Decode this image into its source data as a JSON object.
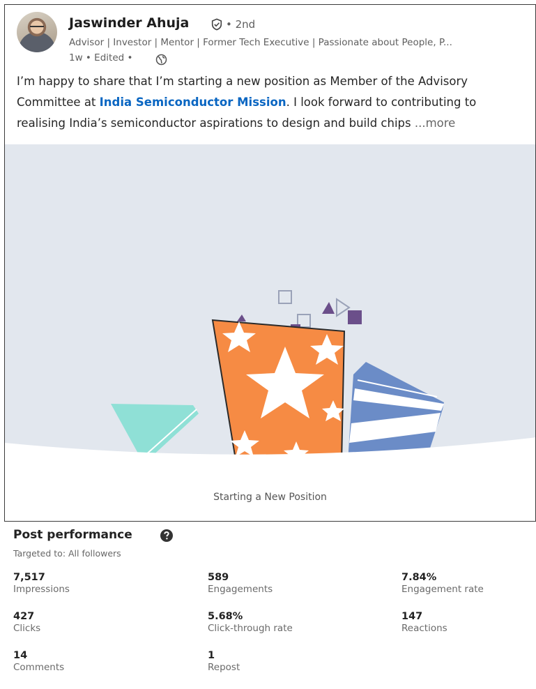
{
  "author": {
    "name": "Jaswinder Ahuja",
    "degree": "• 2nd",
    "headline": "Advisor | Investor | Mentor | Former Tech Executive | Passionate about People, P...",
    "meta": "1w • Edited •"
  },
  "post": {
    "text_part1": "I’m happy to share that I’m starting a new position as Member of the Advisory Committee at ",
    "org_link": "India Semiconductor Mission",
    "text_part2": ". I look forward to contributing to realising India’s semiconductor aspirations to design and build chips ",
    "more_label": "...more",
    "media_caption": "Starting a New Position"
  },
  "performance": {
    "title": "Post performance",
    "targeted": "Targeted to: All followers",
    "metrics": [
      {
        "value": "7,517",
        "label": "Impressions"
      },
      {
        "value": "589",
        "label": "Engagements"
      },
      {
        "value": "7.84%",
        "label": "Engagement rate"
      },
      {
        "value": "427",
        "label": "Clicks"
      },
      {
        "value": "5.68%",
        "label": "Click-through rate"
      },
      {
        "value": "147",
        "label": "Reactions"
      },
      {
        "value": "14",
        "label": "Comments"
      },
      {
        "value": "1",
        "label": "Repost"
      }
    ]
  },
  "icons": {
    "verified": "verified-shield-icon",
    "globe": "globe-icon",
    "help": "help-circle-icon"
  },
  "colors": {
    "link": "#0a66c2",
    "media_bg": "#e2e7ee",
    "orange_box": "#f68b44",
    "teal_shape": "#8fe0d6",
    "blue_shape": "#6b8cc7",
    "purple_accent": "#6b4f8a"
  }
}
